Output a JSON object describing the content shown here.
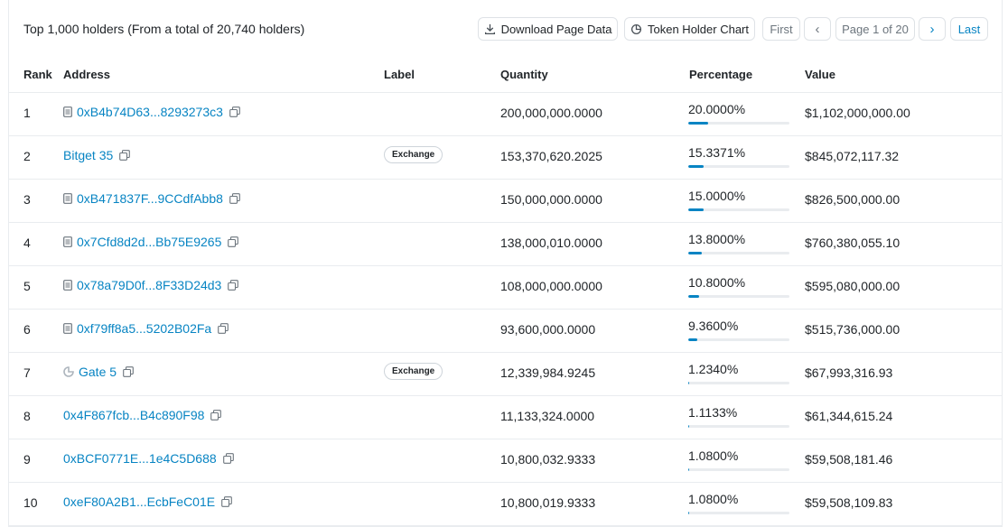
{
  "summary": "Top 1,000 holders (From a total of 20,740 holders)",
  "toolbar": {
    "download_label": "Download Page Data",
    "chart_label": "Token Holder Chart"
  },
  "pagination": {
    "first": "First",
    "prev": "‹",
    "page": "Page 1 of 20",
    "next": "›",
    "last": "Last"
  },
  "columns": {
    "rank": "Rank",
    "address": "Address",
    "label": "Label",
    "quantity": "Quantity",
    "percentage": "Percentage",
    "value": "Value"
  },
  "colors": {
    "accent": "#0784c3",
    "track": "#e9ecef"
  },
  "rows": [
    {
      "rank": "1",
      "address": "0xB4b74D63...8293273c3",
      "icon": "contract-icon",
      "label": "",
      "quantity": "200,000,000.0000",
      "percentage": "20.0000%",
      "pct_value": 20.0,
      "value": "$1,102,000,000.00"
    },
    {
      "rank": "2",
      "address": "Bitget 35",
      "icon": "",
      "label": "Exchange",
      "quantity": "153,370,620.2025",
      "percentage": "15.3371%",
      "pct_value": 15.3371,
      "value": "$845,072,117.32"
    },
    {
      "rank": "3",
      "address": "0xB471837F...9CCdfAbb8",
      "icon": "contract-icon",
      "label": "",
      "quantity": "150,000,000.0000",
      "percentage": "15.0000%",
      "pct_value": 15.0,
      "value": "$826,500,000.00"
    },
    {
      "rank": "4",
      "address": "0x7Cfd8d2d...Bb75E9265",
      "icon": "contract-icon",
      "label": "",
      "quantity": "138,000,010.0000",
      "percentage": "13.8000%",
      "pct_value": 13.8,
      "value": "$760,380,055.10"
    },
    {
      "rank": "5",
      "address": "0x78a79D0f...8F33D24d3",
      "icon": "contract-icon",
      "label": "",
      "quantity": "108,000,000.0000",
      "percentage": "10.8000%",
      "pct_value": 10.8,
      "value": "$595,080,000.00"
    },
    {
      "rank": "6",
      "address": "0xf79ff8a5...5202B02Fa",
      "icon": "contract-icon",
      "label": "",
      "quantity": "93,600,000.0000",
      "percentage": "9.3600%",
      "pct_value": 9.36,
      "value": "$515,736,000.00"
    },
    {
      "rank": "7",
      "address": "Gate 5",
      "icon": "gate-logo-icon",
      "label": "Exchange",
      "quantity": "12,339,984.9245",
      "percentage": "1.2340%",
      "pct_value": 1.234,
      "value": "$67,993,316.93"
    },
    {
      "rank": "8",
      "address": "0x4F867fcb...B4c890F98",
      "icon": "",
      "label": "",
      "quantity": "11,133,324.0000",
      "percentage": "1.1133%",
      "pct_value": 1.1133,
      "value": "$61,344,615.24"
    },
    {
      "rank": "9",
      "address": "0xBCF0771E...1e4C5D688",
      "icon": "",
      "label": "",
      "quantity": "10,800,032.9333",
      "percentage": "1.0800%",
      "pct_value": 1.08,
      "value": "$59,508,181.46"
    },
    {
      "rank": "10",
      "address": "0xeF80A2B1...EcbFeC01E",
      "icon": "",
      "label": "",
      "quantity": "10,800,019.9333",
      "percentage": "1.0800%",
      "pct_value": 1.08,
      "value": "$59,508,109.83"
    }
  ]
}
